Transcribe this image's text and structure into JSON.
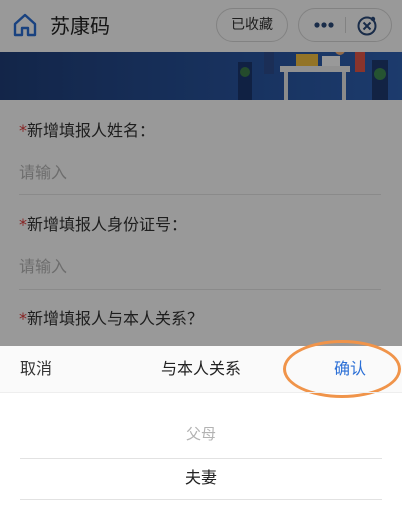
{
  "header": {
    "title": "苏康码",
    "favorite_label": "已收藏",
    "home_icon": "home-icon",
    "more_icon": "more-dots-icon",
    "close_icon": "close-circle-icon"
  },
  "form": {
    "fields": [
      {
        "required_mark": "*",
        "label": "新增填报人姓名：",
        "placeholder": "请输入",
        "value": ""
      },
      {
        "required_mark": "*",
        "label": "新增填报人身份证号：",
        "placeholder": "请输入",
        "value": ""
      },
      {
        "required_mark": "*",
        "label": "新增填报人与本人关系？"
      }
    ]
  },
  "picker": {
    "cancel_label": "取消",
    "title": "与本人关系",
    "confirm_label": "确认",
    "options": [
      "父母",
      "夫妻"
    ],
    "selected": "夫妻"
  },
  "colors": {
    "accent": "#2b6fd6",
    "required": "#e03a3a",
    "highlight": "#f0944a"
  }
}
